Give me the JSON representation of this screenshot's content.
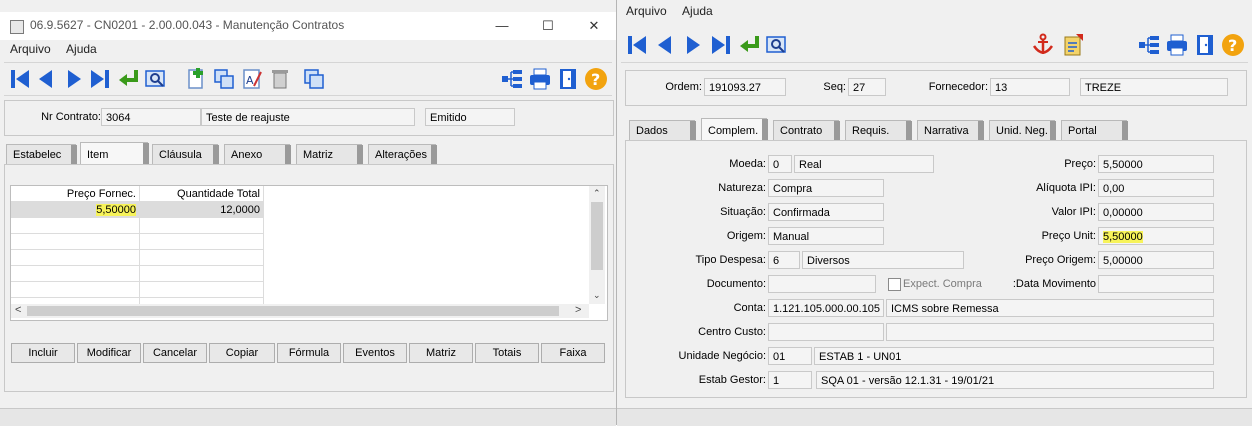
{
  "left": {
    "title": "06.9.5627 - CN0201 - 2.00.00.043 - Manutenção Contratos",
    "menu": [
      "Arquivo",
      "Ajuda"
    ],
    "header": {
      "nr_contrato_label": "Nr Contrato:",
      "nr_contrato": "3064",
      "descricao": "Teste de reajuste",
      "status": "Emitido"
    },
    "tabs": [
      "Estabelec",
      "Item",
      "Cláusula",
      "Anexo",
      "Matriz",
      "Alterações"
    ],
    "grid": {
      "columns": [
        "Preço Fornec.",
        "Quantidade Total"
      ],
      "rows": [
        [
          "5,50000",
          "12,0000"
        ]
      ]
    },
    "buttons": [
      "Incluir",
      "Modificar",
      "Cancelar",
      "Copiar",
      "Fórmula",
      "Eventos",
      "Matriz",
      "Totais",
      "Faixa"
    ]
  },
  "right": {
    "menu": [
      "Arquivo",
      "Ajuda"
    ],
    "header": {
      "ordem_label": "Ordem:",
      "ordem": "191093.27",
      "seq_label": "Seq:",
      "seq": "27",
      "fornecedor_label": "Fornecedor:",
      "fornecedor": "13",
      "fornecedor_nome": "TREZE"
    },
    "tabs": [
      "Dados",
      "Complem.",
      "Contrato",
      "Requis.",
      "Narrativa",
      "Unid. Neg.",
      "Portal"
    ],
    "form": {
      "moeda_label": "Moeda:",
      "moeda_cod": "0",
      "moeda": "Real",
      "natureza_label": "Natureza:",
      "natureza": "Compra",
      "situacao_label": "Situação:",
      "situacao": "Confirmada",
      "origem_label": "Origem:",
      "origem": "Manual",
      "tipo_despesa_label": "Tipo Despesa:",
      "tipo_despesa_cod": "6",
      "tipo_despesa": "Diversos",
      "documento_label": "Documento:",
      "documento": "",
      "expect_compra": "Expect. Compra",
      "conta_label": "Conta:",
      "conta": "1.121.105.000.00.105",
      "conta_desc": "ICMS sobre Remessa",
      "centro_custo_label": "Centro Custo:",
      "unidade_negocio_label": "Unidade Negócio:",
      "unidade_negocio_cod": "01",
      "unidade_negocio": "ESTAB 1 - UN01",
      "estab_gestor_label": "Estab Gestor:",
      "estab_gestor_cod": "1",
      "estab_gestor": "SQA 01 - versão 12.1.31 - 19/01/21",
      "preco_label": "Preço:",
      "preco": "5,50000",
      "aliquota_ipi_label": "Alíquota IPI:",
      "aliquota_ipi": "0,00",
      "valor_ipi_label": "Valor IPI:",
      "valor_ipi": "0,00000",
      "preco_unit_label": "Preço Unit:",
      "preco_unit": "5,50000",
      "preco_origem_label": "Preço Origem:",
      "preco_origem": "5,00000",
      "data_movimento_label": "Data Movimento:"
    }
  },
  "colors": {
    "nav_blue": "#1f5fd1",
    "highlight": "#f7f35a",
    "help_orange": "#f2a30f",
    "anchor_red": "#d22a1c"
  }
}
